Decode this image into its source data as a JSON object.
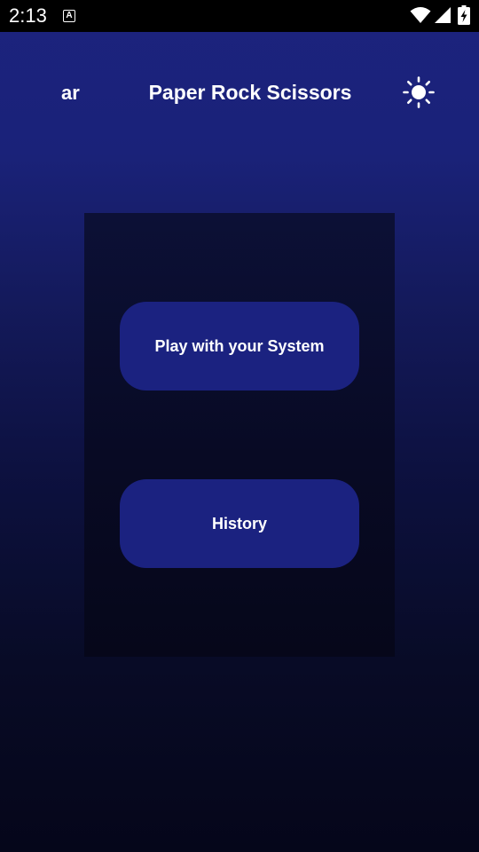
{
  "status_bar": {
    "time": "2:13",
    "app_icon_letter": "A"
  },
  "header": {
    "language_toggle": "ar",
    "title": "Paper Rock Scissors",
    "theme_icon": "sun-icon"
  },
  "menu": {
    "play_label": "Play with your System",
    "history_label": "History"
  },
  "colors": {
    "background_top": "#1c237e",
    "background_bottom": "#05061a",
    "card": "#0a0d2e",
    "button": "#1b2280",
    "text": "#ffffff"
  }
}
